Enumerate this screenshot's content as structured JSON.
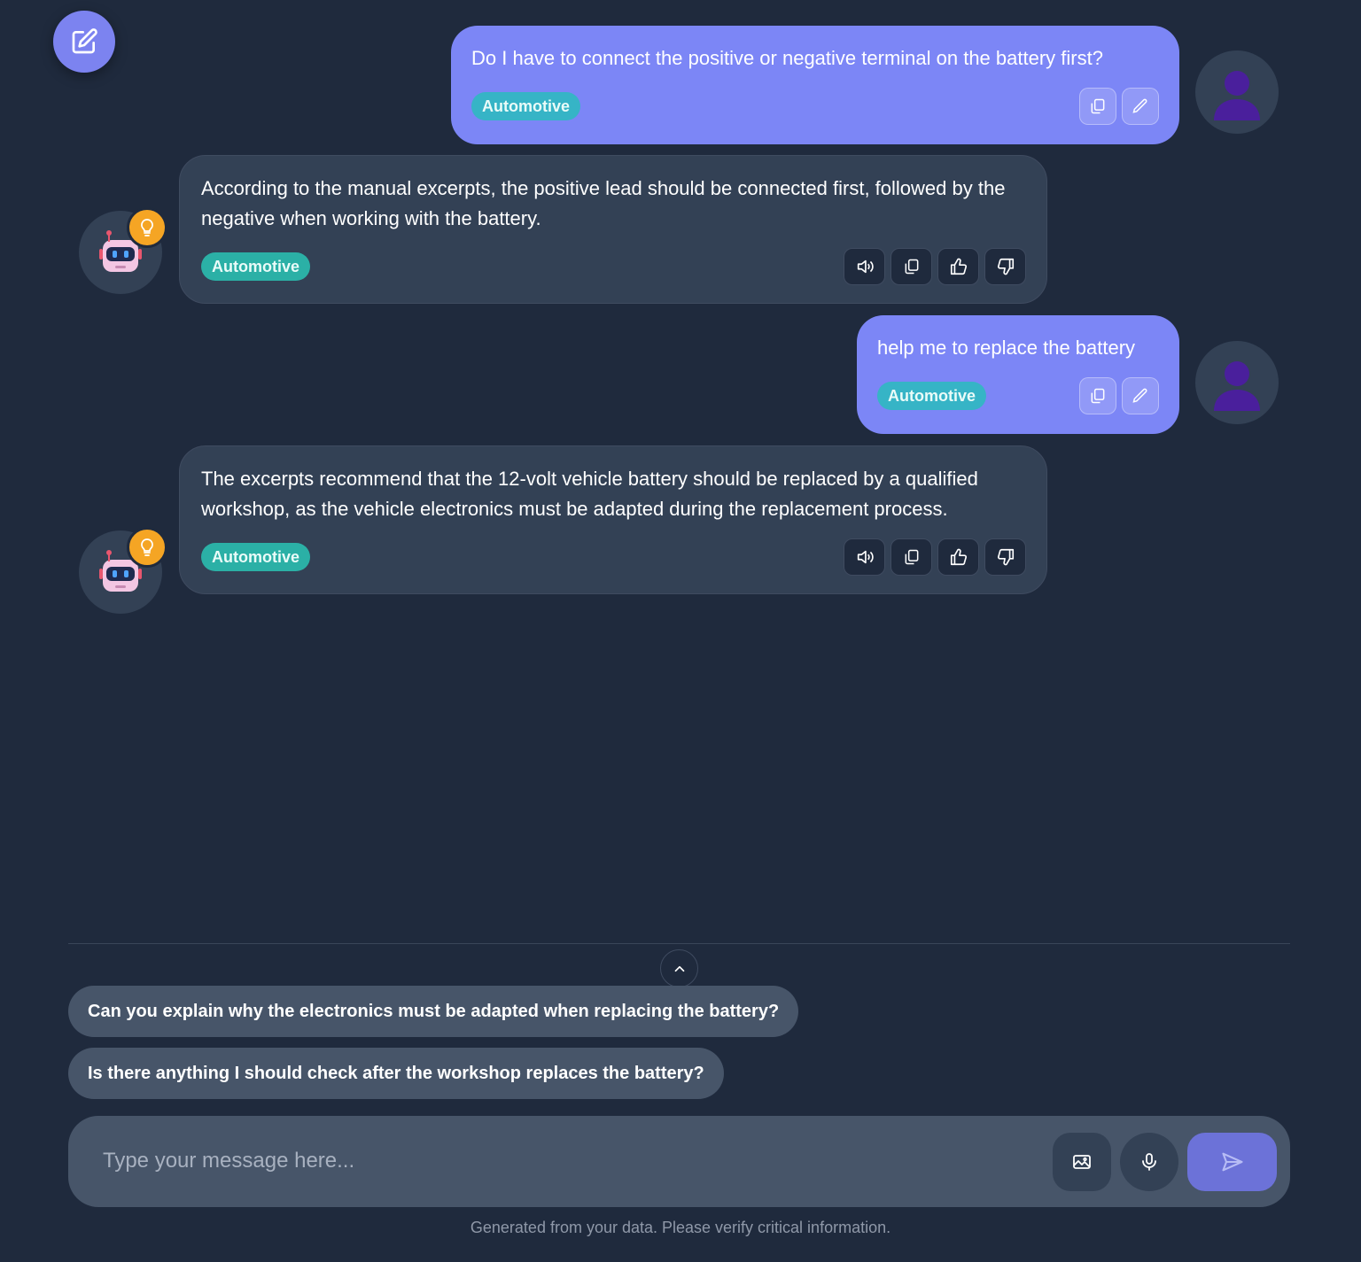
{
  "toolbar": {
    "new_chat_icon": "edit-square-icon"
  },
  "messages": [
    {
      "role": "user",
      "text": "Do I have to connect the positive or negative terminal on the battery first?",
      "tag": "Automotive"
    },
    {
      "role": "assistant",
      "text": "According to the manual excerpts, the positive lead should be connected first, followed by the negative when working with the battery.",
      "tag": "Automotive"
    },
    {
      "role": "user",
      "text": "help me to replace the battery",
      "tag": "Automotive"
    },
    {
      "role": "assistant",
      "text": "The excerpts recommend that the 12-volt vehicle battery should be replaced by a qualified workshop, as the vehicle electronics must be adapted during the replacement process.",
      "tag": "Automotive"
    }
  ],
  "suggestions": [
    "Can you explain why the electronics must be adapted when replacing the battery?",
    "Is there anything I should check after the workshop replaces the battery?"
  ],
  "composer": {
    "placeholder": "Type your message here..."
  },
  "footer": {
    "disclaimer": "Generated from your data. Please verify critical information."
  },
  "colors": {
    "background": "#1f2a3d",
    "user_bubble": "#7c86f6",
    "bot_bubble": "#334155",
    "tag": "#2bb0a6",
    "accent": "#7c83f0"
  }
}
